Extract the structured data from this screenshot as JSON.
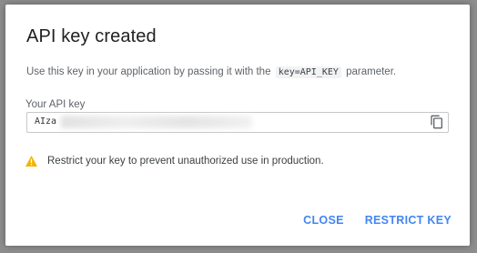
{
  "dialog": {
    "title": "API key created",
    "desc_before": "Use this key in your application by passing it with the",
    "desc_code": "key=API_KEY",
    "desc_after": "parameter.",
    "field_label": "Your API key",
    "key_prefix": "AIza",
    "copy_icon": "copy-icon",
    "warning_icon": "warning-icon",
    "warning_text": "Restrict your key to prevent unauthorized use in production.",
    "close_label": "CLOSE",
    "restrict_label": "RESTRICT KEY"
  },
  "colors": {
    "accent": "#4285f4",
    "warning": "#f4b400",
    "backdrop": "#8e8e8e"
  }
}
